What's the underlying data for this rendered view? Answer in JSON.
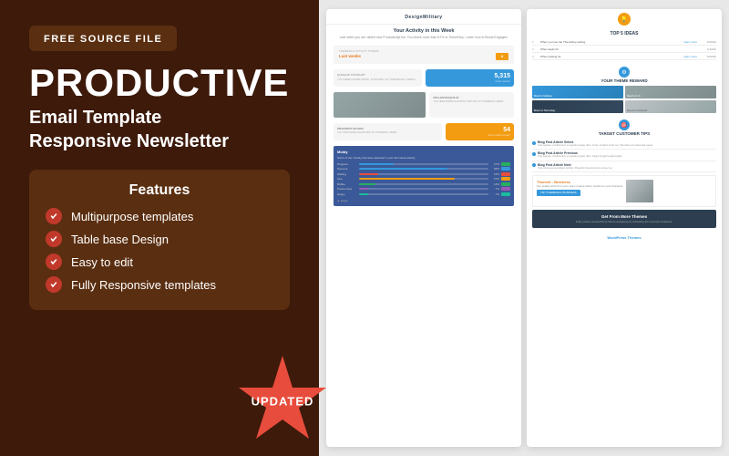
{
  "left": {
    "badge": "FREE SOURCE FILE",
    "title": "PRODUCTIVE",
    "subtitle_line1": "Email Template",
    "subtitle_line2": "Responsive Newsletter",
    "features_title": "Features",
    "features": [
      {
        "id": "multipurpose",
        "text": "Multipurpose templates"
      },
      {
        "id": "table-base",
        "text": "Table base Design"
      },
      {
        "id": "easy-edit",
        "text": "Easy to edit"
      },
      {
        "id": "responsive",
        "text": "Fully Responsive templates"
      }
    ],
    "updated_label": "UPDATED"
  },
  "preview_left": {
    "logo": "DesignMilitary",
    "section_title": "Your Activity in this Week",
    "body_text": "Last week you are visited new ProductivityHub. You check more than 67% of ThemeSup. Learn how to Boost Engaged.",
    "streak_title": "Last weeks",
    "streak_sub": "THEMESILK ACTIVITY STREAK",
    "metric1_title": "QUISQUE TINCIDUNT",
    "metric1_sub": "YOU NEED MORE PROD. THAN 88% OF THEMESILK USERS.",
    "metric1_value": "5,315",
    "metric1_label": "lorem ipsum",
    "metric2_title": "PELLENTESQUE IN",
    "metric2_sub": "YOU NEED MORE ACCURATE THAN 49% OF THEMESILK USERS",
    "metric3_title": "PRAESENT MAURIS",
    "metric3_sub": "YOU HAVE MORE MAURIS 86% OF THEMESILK USERS",
    "metric3_value": "54",
    "metric3_label": "lorem lorem lorem",
    "table_title": "Moldy",
    "table_sub": "Some of the molody that were detected in your last week activity.",
    "table_rows": [
      {
        "label": "Progress",
        "pct": "27%",
        "fill": 27
      },
      {
        "label": "Success",
        "pct": "68%",
        "fill": 68
      },
      {
        "label": "Waiting",
        "pct": "15%",
        "fill": 15
      },
      {
        "label": "Like",
        "pct": "74%",
        "fill": 74
      },
      {
        "label": "Dislike",
        "pct": "13%",
        "fill": 13
      },
      {
        "label": "Preferences",
        "pct": "7%",
        "fill": 7
      },
      {
        "label": "Happy",
        "pct": "7%",
        "fill": 7
      }
    ]
  },
  "preview_right": {
    "top5_title": "TOP 5 IDEAS",
    "ideas": [
      {
        "num": "1.",
        "text": "When you use the ThemeSup setting",
        "link": "learn more",
        "tag": "0-5click"
      },
      {
        "num": "2.",
        "text": "When apply for",
        "link": "",
        "tag": "0-4click"
      },
      {
        "num": "3.",
        "text": "When looking for",
        "link": "learn more",
        "tag": "0-5click"
      }
    ],
    "theme_reward_title": "YOUR THEME REWARD",
    "theme_cards": [
      {
        "label": "Board to Software"
      },
      {
        "label": "Report on Us"
      },
      {
        "label": "Board on Technology"
      },
      {
        "label": "Speed on Computer"
      }
    ],
    "target_title": "TARGET CUSTOMER TIPS",
    "links": [
      {
        "title": "Blog Post Article Select",
        "desc": "Cras egestas, condimentum ut egestas feugiat, diam. Curae; tincidunt morbi nec. Ulla tellus est malesuada egeste."
      },
      {
        "title": "Blog Post Article Previous",
        "desc": "Cras egestas, condimentum ut egestas feugiat, diam. Integer feugiat diam. Integer feugiat feugiat feugiat. Undcumeet enim. Nam cu egyue. Molestum est."
      },
      {
        "title": "Blog Post Article Next",
        "desc": "Cras consequat sed sed aliquet porttitor. Phasellus financed purus. Sed est aliquet porttitor. Phasellus financed purus semper vel."
      }
    ],
    "biz_brand": "Themelr - Business",
    "biz_text": "Top quality work from your team means better results for your business.",
    "biz_btn": "TRY THEMESILK BUSINESS",
    "cta_title": "Get From More Themes",
    "cta_text": "Fully protect yourself from theme designing by activating all 4 premium features.",
    "footer_text": "WordPress Themes"
  },
  "colors": {
    "primary_dark": "#3d1a0a",
    "feature_bg": "#5a2e10",
    "accent_red": "#e74c3c",
    "blue": "#3498db",
    "yellow": "#f39c12",
    "dark_navy": "#2c3e50"
  }
}
